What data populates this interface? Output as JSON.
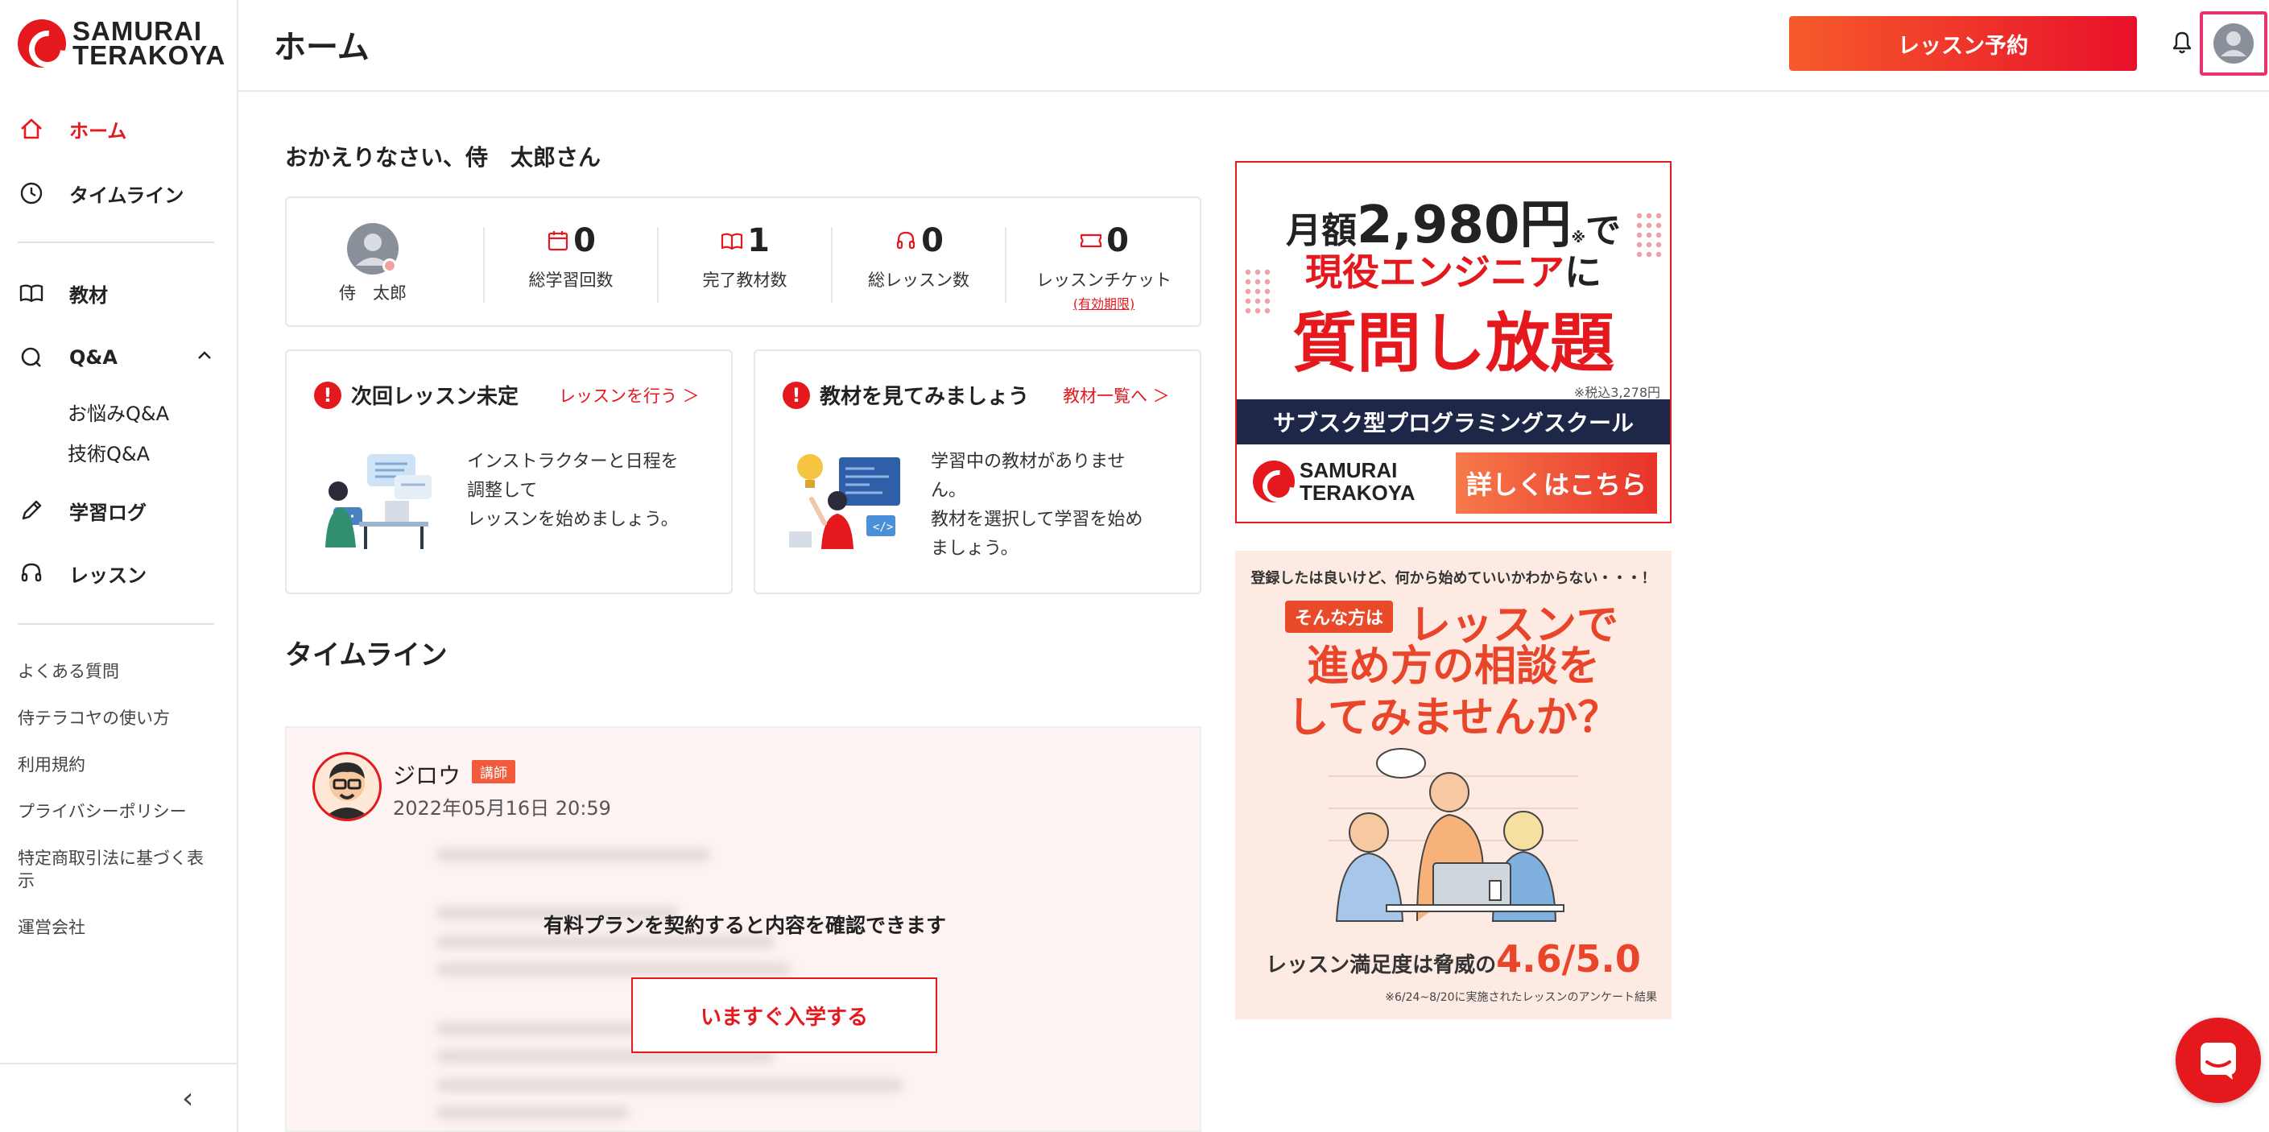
{
  "brand": {
    "line1": "SAMURAI",
    "line2": "TERAKOYA"
  },
  "header": {
    "title": "ホーム",
    "reserve_label": "レッスン予約"
  },
  "sidebar": {
    "nav": [
      {
        "label": "ホーム",
        "icon": "home-icon"
      },
      {
        "label": "タイムライン",
        "icon": "clock-icon"
      },
      {
        "label": "教材",
        "icon": "book-icon"
      },
      {
        "label": "Q&A",
        "icon": "qa-icon"
      },
      {
        "label": "学習ログ",
        "icon": "pencil-icon"
      },
      {
        "label": "レッスン",
        "icon": "headset-icon"
      }
    ],
    "qa_sub": [
      "お悩みQ&A",
      "技術Q&A"
    ],
    "footer_links": [
      "よくある質問",
      "侍テラコヤの使い方",
      "利用規約",
      "プライバシーポリシー",
      "特定商取引法に基づく表示",
      "運営会社"
    ],
    "collapse_glyph": "‹"
  },
  "greeting": "おかえりなさい、侍　太郎さん",
  "profile": {
    "name": "侍　太郎"
  },
  "stats": [
    {
      "value": "0",
      "label": "総学習回数"
    },
    {
      "value": "1",
      "label": "完了教材数"
    },
    {
      "value": "0",
      "label": "総レッスン数"
    },
    {
      "value": "0",
      "label": "レッスンチケット",
      "sub": "(有効期限)"
    }
  ],
  "cards": {
    "lesson": {
      "title": "次回レッスン未定",
      "link": "レッスンを行う ＞",
      "lines": [
        "インストラクターと日程を",
        "調整して",
        "レッスンを始めましょう。"
      ]
    },
    "material": {
      "title": "教材を見てみましょう",
      "link": "教材一覧へ ＞",
      "lines": [
        "学習中の教材がありませ",
        "ん。",
        "教材を選択して学習を始め",
        "ましょう。"
      ]
    }
  },
  "timeline": {
    "title": "タイムライン",
    "post": {
      "author": "ジロウ",
      "badge": "講師",
      "date": "2022年05月16日 20:59",
      "paywall_message": "有料プランを契約すると内容を確認できます",
      "enroll_label": "いますぐ入学する"
    }
  },
  "banner1": {
    "line1_pre": "月額",
    "price": "2,980円",
    "mark": "※",
    "line1_post": "で",
    "line2a": "現役エンジニア",
    "line2b": "に",
    "line3": "質問し放題",
    "tax": "※税込3,278円",
    "bar": "サブスク型プログラミングスクール",
    "logo1": "SAMURAI",
    "logo2": "TERAKOYA",
    "cta": "詳しくはこちら"
  },
  "banner2": {
    "top": "登録したは良いけど、何から始めていいかわからない・・・！",
    "tag": "そんな方は",
    "h1": "レッスンで",
    "h2a": "進め方の相談を",
    "h2b": "してみませんか？",
    "foot_pre": "レッスン満足度は脅威の",
    "foot_score": "4.6/5.0",
    "foot_note": "※6/24~8/20に実施されたレッスンのアンケート結果"
  },
  "colors": {
    "accent": "#e5181e",
    "navy": "#1e2748",
    "banner2_bg": "#fdeae3"
  }
}
